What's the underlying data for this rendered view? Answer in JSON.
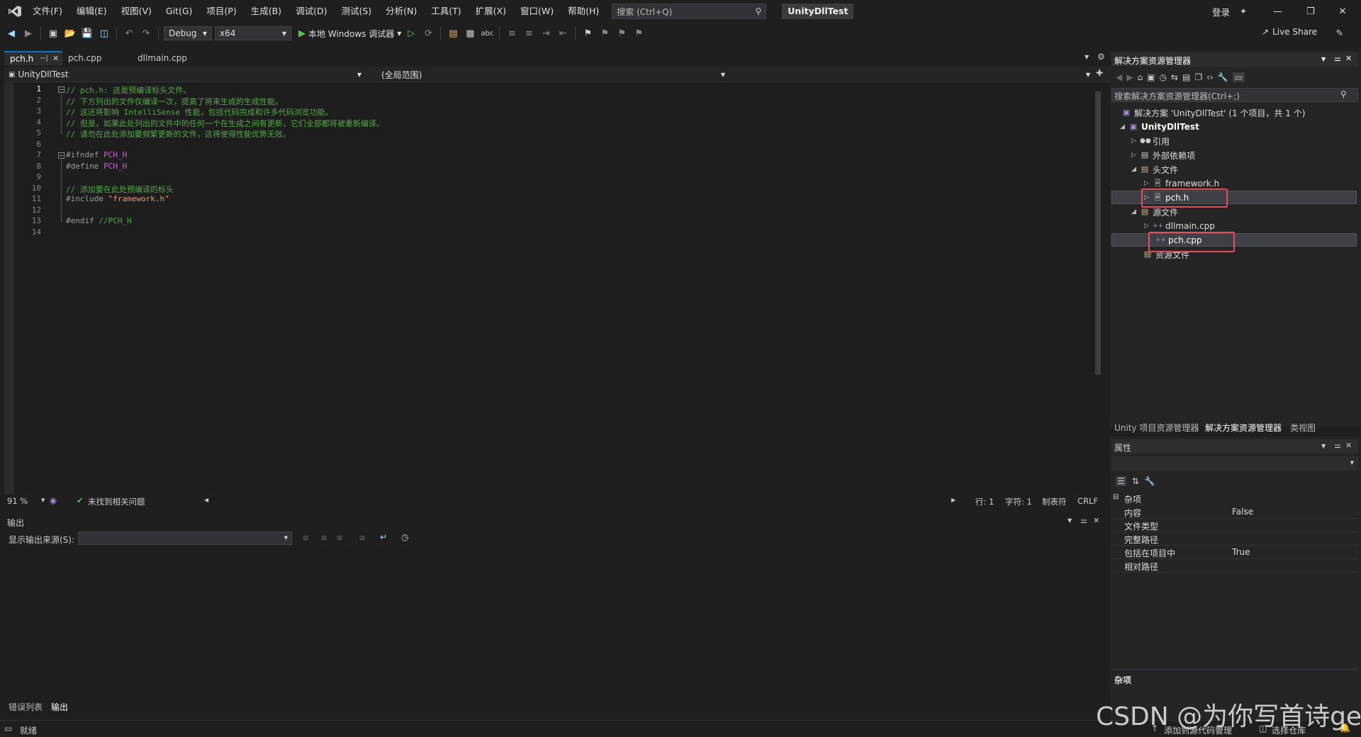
{
  "titlebar": {
    "menus": [
      "文件(F)",
      "编辑(E)",
      "视图(V)",
      "Git(G)",
      "项目(P)",
      "生成(B)",
      "调试(D)",
      "测试(S)",
      "分析(N)",
      "工具(T)",
      "扩展(X)",
      "窗口(W)",
      "帮助(H)"
    ],
    "search_placeholder": "搜索 (Ctrl+Q)",
    "solution_name": "UnityDllTest",
    "login": "登录"
  },
  "toolbar": {
    "config": "Debug",
    "platform": "x64",
    "run_label": "本地 Windows 调试器",
    "live_share": "Live Share"
  },
  "editor_tabs": [
    "pch.h",
    "pch.cpp",
    "dllmain.cpp"
  ],
  "navbar": {
    "project": "UnityDllTest",
    "scope": "(全局范围)"
  },
  "code_lines": [
    {
      "n": "1",
      "segments": [
        {
          "t": "// pch.h: 这是预编译标头文件。",
          "c": "cm"
        }
      ]
    },
    {
      "n": "2",
      "segments": [
        {
          "t": "// 下方列出的文件仅编译一次，提高了将来生成的生成性能。",
          "c": "cm"
        }
      ]
    },
    {
      "n": "3",
      "segments": [
        {
          "t": "// 这还将影响 IntelliSense 性能，包括代码完成和许多代码浏览功能。",
          "c": "cm"
        }
      ]
    },
    {
      "n": "4",
      "segments": [
        {
          "t": "// 但是，如果此处列出的文件中的任何一个在生成之间有更新，它们全部都将被重新编译。",
          "c": "cm"
        }
      ]
    },
    {
      "n": "5",
      "segments": [
        {
          "t": "// 请勿在此处添加要频繁更新的文件，这将使得性能优势无效。",
          "c": "cm"
        }
      ]
    },
    {
      "n": "6",
      "segments": []
    },
    {
      "n": "7",
      "segments": [
        {
          "t": "#ifndef ",
          "c": "kw"
        },
        {
          "t": "PCH_H",
          "c": "mc"
        }
      ]
    },
    {
      "n": "8",
      "segments": [
        {
          "t": "#define ",
          "c": "kw"
        },
        {
          "t": "PCH_H",
          "c": "mc"
        }
      ]
    },
    {
      "n": "9",
      "segments": []
    },
    {
      "n": "10",
      "segments": [
        {
          "t": "// 添加要在此处预编译的标头",
          "c": "cm"
        }
      ]
    },
    {
      "n": "11",
      "segments": [
        {
          "t": "#include ",
          "c": "kw"
        },
        {
          "t": "\"framework.h\"",
          "c": "st"
        }
      ]
    },
    {
      "n": "12",
      "segments": []
    },
    {
      "n": "13",
      "segments": [
        {
          "t": "#endif ",
          "c": "kw"
        },
        {
          "t": "//PCH_H",
          "c": "cm"
        }
      ]
    },
    {
      "n": "14",
      "segments": []
    }
  ],
  "editor_status": {
    "zoom": "91 %",
    "issues": "未找到相关问题",
    "line": "行: 1",
    "col": "字符: 1",
    "tabs": "制表符",
    "eol": "CRLF"
  },
  "output": {
    "title": "输出",
    "source_label": "显示输出来源(S):",
    "source_value": ""
  },
  "bottom_tabs": [
    "错误列表",
    "输出"
  ],
  "statusbar": {
    "ready": "就绪",
    "add_source": "添加到源代码管理",
    "select_repo": "选择仓库"
  },
  "solution_explorer": {
    "title": "解决方案资源管理器",
    "search_placeholder": "搜索解决方案资源管理器(Ctrl+;)",
    "solution_label": "解决方案 'UnityDllTest' (1 个项目，共 1 个)",
    "project": "UnityDllTest",
    "nodes": {
      "refs": "引用",
      "external": "外部依赖项",
      "headers": "头文件",
      "framework_h": "framework.h",
      "pch_h": "pch.h",
      "sources": "源文件",
      "dllmain_cpp": "dllmain.cpp",
      "pch_cpp": "pch.cpp",
      "resources": "资源文件"
    },
    "bottom_tabs": [
      "Unity 项目资源管理器",
      "解决方案资源管理器",
      "类视图"
    ]
  },
  "properties": {
    "title": "属性",
    "category": "杂项",
    "rows": [
      {
        "k": "内容",
        "v": "False"
      },
      {
        "k": "文件类型",
        "v": ""
      },
      {
        "k": "完整路径",
        "v": ""
      },
      {
        "k": "包括在项目中",
        "v": "True"
      },
      {
        "k": "相对路径",
        "v": ""
      }
    ],
    "footer": "杂项"
  },
  "watermark": "CSDN @为你写首诗ge",
  "colors": {
    "accent": "#007acc",
    "highlight": "#e84b5c",
    "comment": "#57a64a",
    "macro": "#bd63c5",
    "string": "#d69d85"
  }
}
